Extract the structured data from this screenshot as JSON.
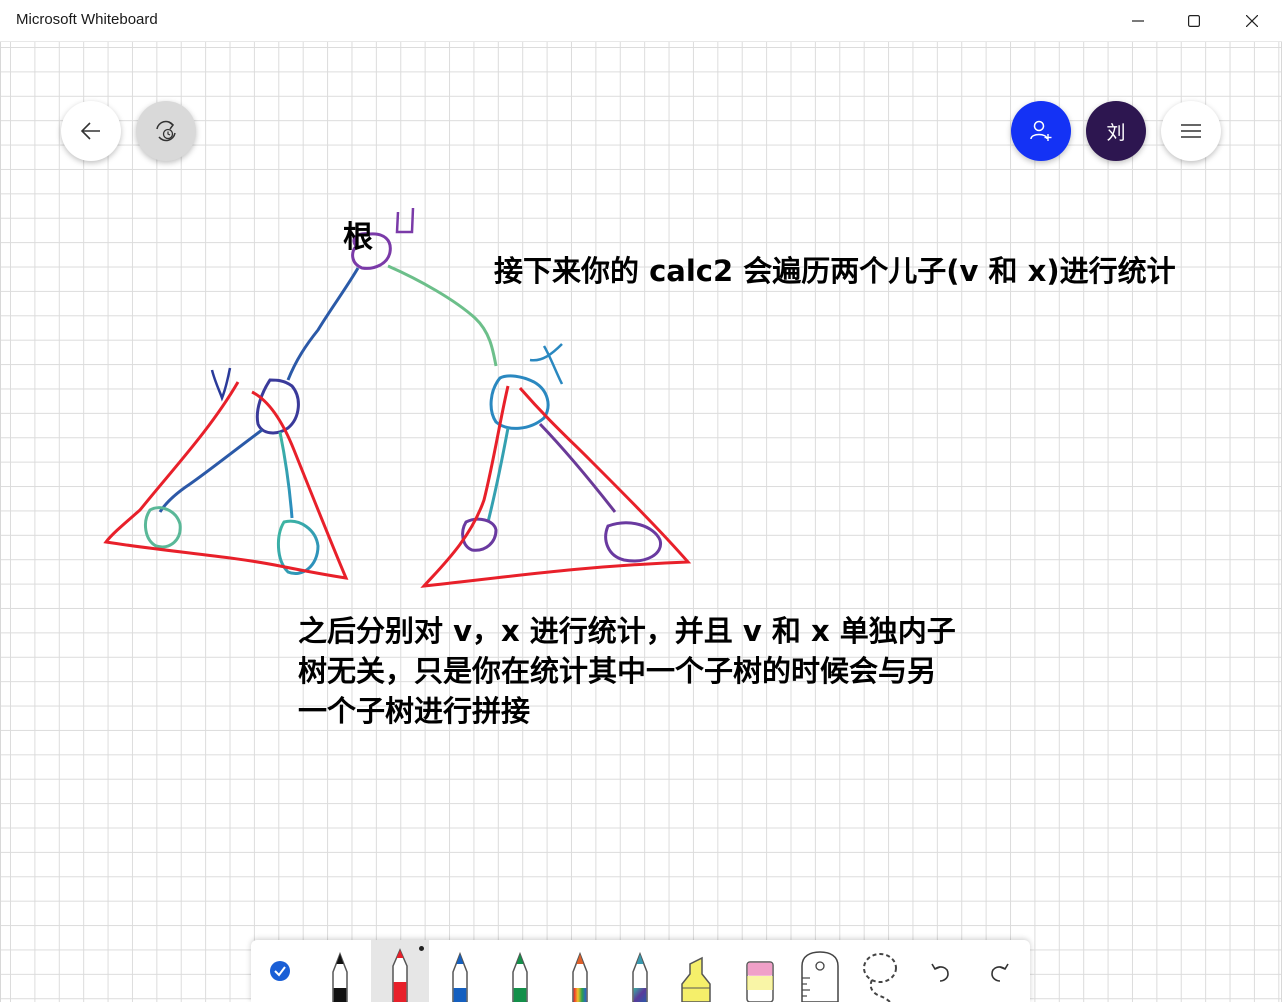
{
  "window": {
    "title": "Microsoft Whiteboard",
    "controls": [
      "minimize",
      "maximize",
      "close"
    ]
  },
  "top_left_buttons": [
    {
      "name": "back-button",
      "icon": "arrow-left-icon"
    },
    {
      "name": "sync-button",
      "icon": "sync-history-icon"
    }
  ],
  "top_right": {
    "invite_icon": "add-person-icon",
    "invite_color": "#1432f5",
    "avatar_initial": "刘",
    "avatar_color": "#2d1650",
    "menu_icon": "hamburger-icon"
  },
  "board": {
    "label_root": "根",
    "label_u": "u",
    "label_v": "v",
    "label_x": "x",
    "note_top": "接下来你的 calc2 会遍历两个儿子(v 和 x)进行统计",
    "note_bottom_lines": [
      "之后分别对 v，x 进行统计，并且 v 和 x 单独内子",
      "树无关，只是你在统计其中一个子树的时候会与另",
      "一个子树进行拼接"
    ]
  },
  "toolbar": {
    "tools": [
      {
        "name": "select-tool",
        "icon": "checkmark-icon",
        "color": "#1a5fd6"
      },
      {
        "name": "pen-black",
        "icon": "pen-icon",
        "color": "#111111"
      },
      {
        "name": "pen-red",
        "icon": "pen-icon",
        "color": "#e8202a",
        "selected": true
      },
      {
        "name": "pen-blue",
        "icon": "pen-icon",
        "color": "#1560c0"
      },
      {
        "name": "pen-green",
        "icon": "pen-icon",
        "color": "#14904a"
      },
      {
        "name": "pen-rainbow",
        "icon": "pen-icon",
        "color": "#e0602a"
      },
      {
        "name": "pen-galaxy",
        "icon": "pen-icon",
        "color": "#3a7ab0"
      },
      {
        "name": "highlighter",
        "icon": "highlighter-icon",
        "color": "#f5ef6a"
      },
      {
        "name": "eraser",
        "icon": "eraser-icon",
        "color": "#f0a0c8"
      },
      {
        "name": "ruler",
        "icon": "ruler-icon",
        "color": "#444444"
      },
      {
        "name": "lasso",
        "icon": "lasso-icon",
        "color": "#444444"
      },
      {
        "name": "undo",
        "icon": "undo-icon",
        "color": "#333333"
      },
      {
        "name": "redo",
        "icon": "redo-icon",
        "color": "#333333"
      }
    ]
  }
}
